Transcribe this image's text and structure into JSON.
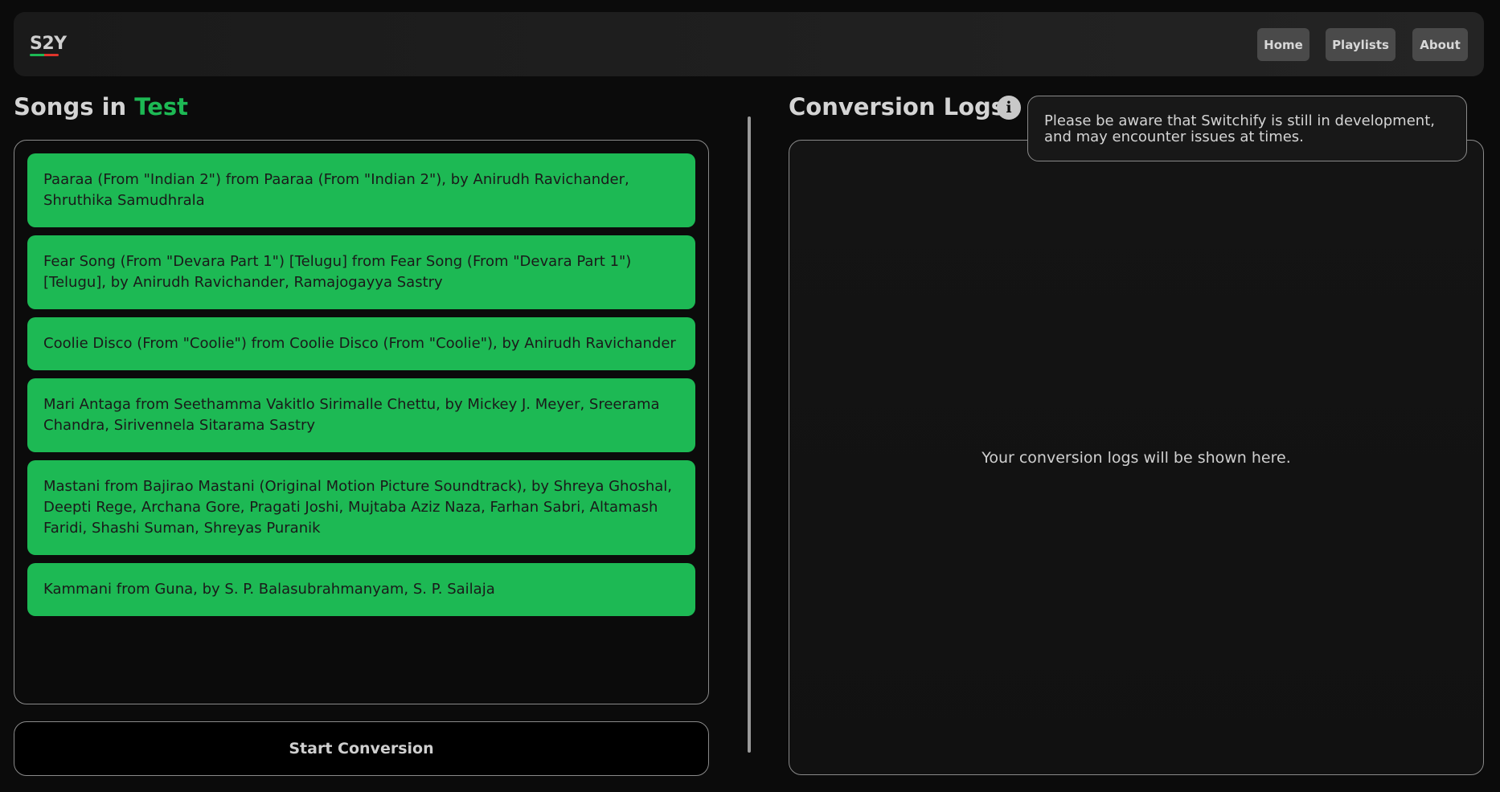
{
  "app": {
    "logo": "S2Y"
  },
  "nav": {
    "home": "Home",
    "playlists": "Playlists",
    "about": "About"
  },
  "songs_panel": {
    "heading_prefix": "Songs in ",
    "playlist_name": "Test",
    "songs": [
      "Paaraa (From \"Indian 2\") from Paaraa (From \"Indian 2\"), by Anirudh Ravichander, Shruthika Samudhrala",
      "Fear Song (From \"Devara Part 1\") [Telugu] from Fear Song (From \"Devara Part 1\") [Telugu], by Anirudh Ravichander, Ramajogayya Sastry",
      "Coolie Disco (From \"Coolie\") from Coolie Disco (From \"Coolie\"), by Anirudh Ravichander",
      "Mari Antaga from Seethamma Vakitlo Sirimalle Chettu, by Mickey J. Meyer, Sreerama Chandra, Sirivennela Sitarama Sastry",
      "Mastani from Bajirao Mastani (Original Motion Picture Soundtrack), by Shreya Ghoshal, Deepti Rege, Archana Gore, Pragati Joshi, Mujtaba Aziz Naza, Farhan Sabri, Altamash Faridi, Shashi Suman, Shreyas Puranik",
      "Kammani from Guna, by S. P. Balasubrahmanyam, S. P. Sailaja"
    ],
    "start_button": "Start Conversion"
  },
  "logs_panel": {
    "heading": "Conversion Logs",
    "info_icon": "info-icon",
    "tooltip": "Please be aware that Switchify is still in development, and may encounter issues at times.",
    "empty_message": "Your conversion logs will be shown here."
  },
  "colors": {
    "accent": "#1db954",
    "background": "#0b0b0b"
  }
}
